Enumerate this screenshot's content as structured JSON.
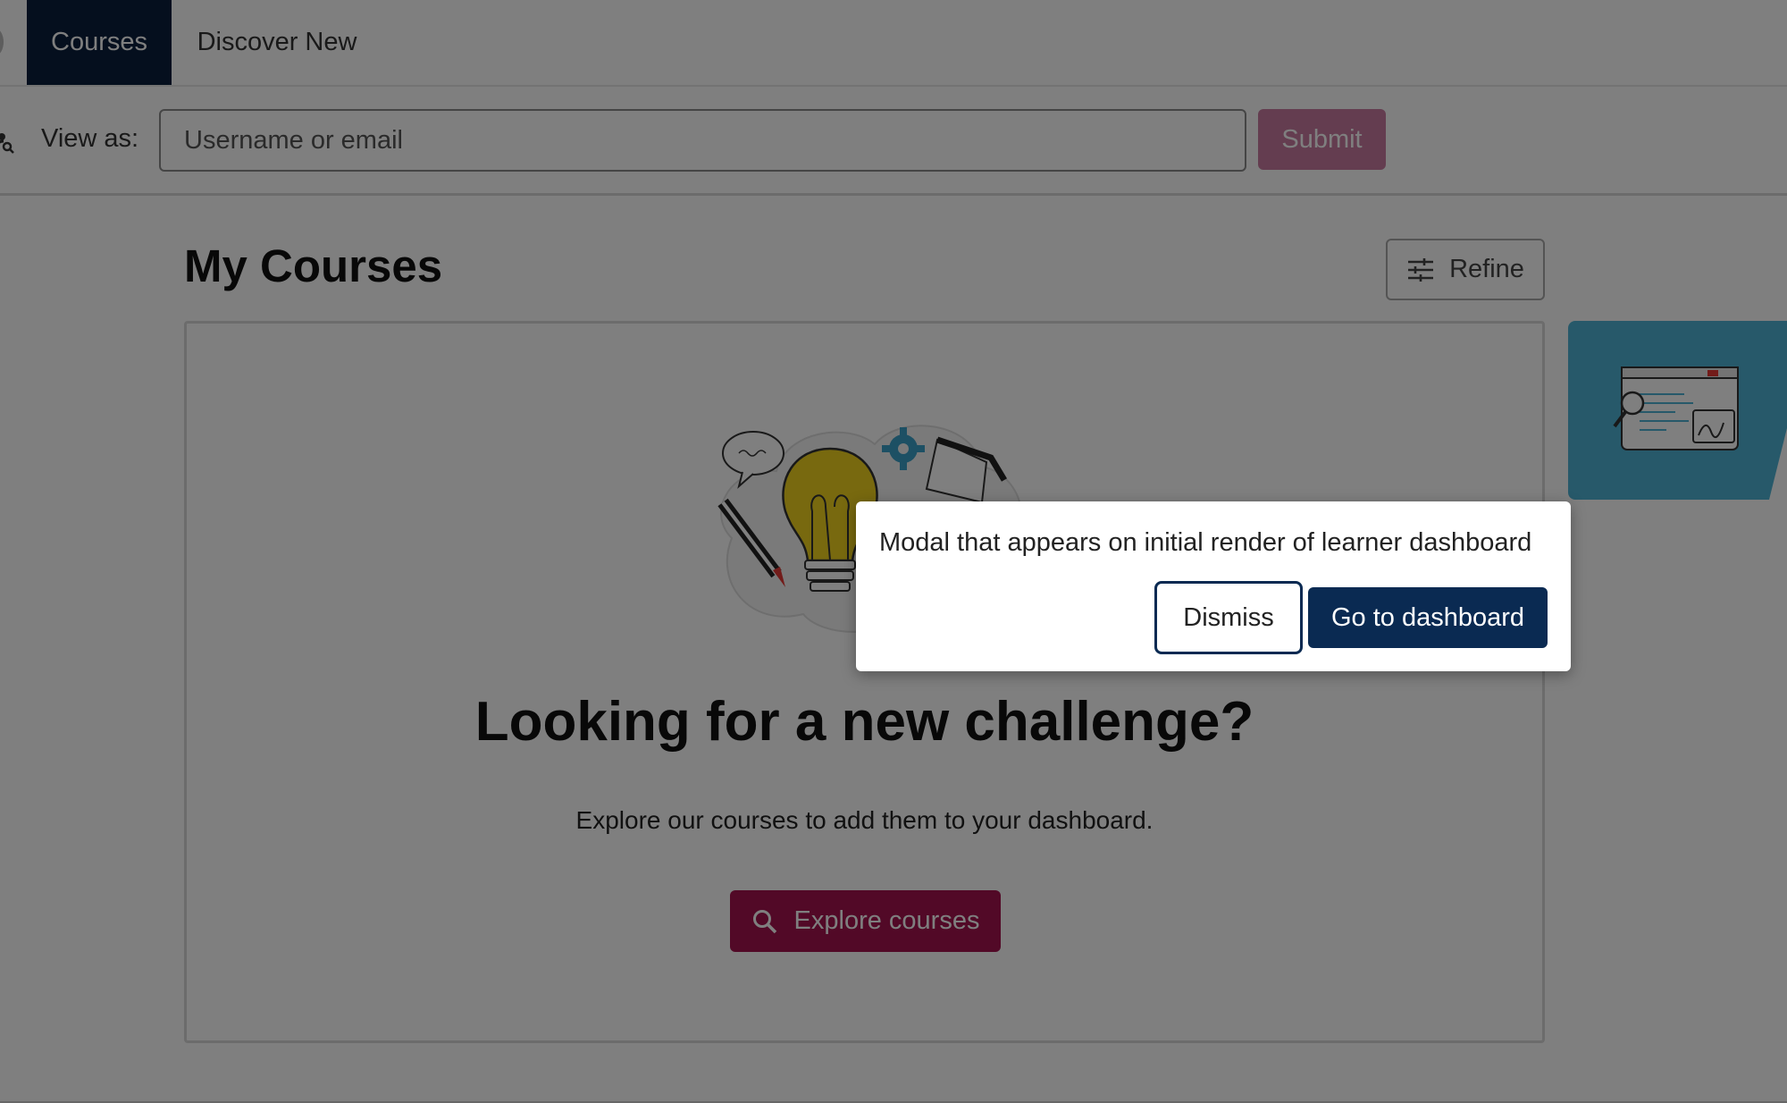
{
  "nav": {
    "tabs": [
      {
        "label": "Courses",
        "active": true
      },
      {
        "label": "Discover New",
        "active": false
      }
    ]
  },
  "masquerade": {
    "label": "View as:",
    "placeholder": "Username or email",
    "submit_label": "Submit"
  },
  "main": {
    "title": "My Courses",
    "refine_label": "Refine",
    "empty": {
      "heading": "Looking for a new challenge?",
      "text": "Explore our courses to add them to your dashboard.",
      "button_label": "Explore courses"
    }
  },
  "modal": {
    "text": "Modal that appears on initial render of learner dashboard",
    "dismiss_label": "Dismiss",
    "primary_label": "Go to dashboard"
  },
  "colors": {
    "nav_active": "#0a1f3d",
    "brand_primary": "#0a2a52",
    "brand_accent": "#a4124e",
    "side_card": "#4fb3d4"
  },
  "icons": [
    "masquerade-search-icon",
    "refine-sliders-icon",
    "search-icon",
    "lightbulb-illustration",
    "browser-illustration"
  ]
}
